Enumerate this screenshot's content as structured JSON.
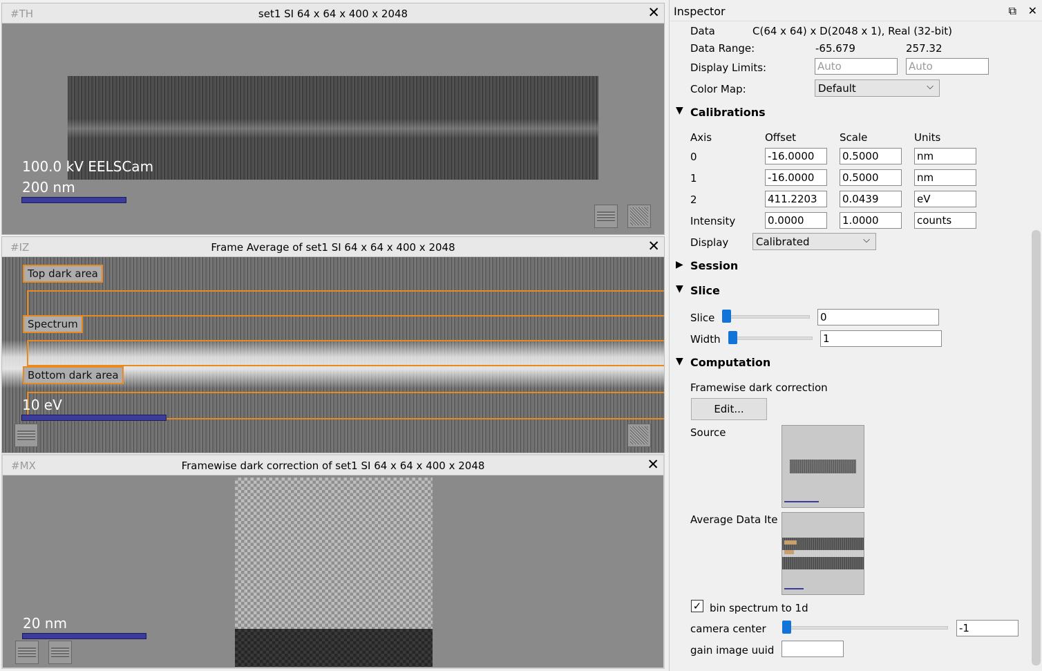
{
  "panels": {
    "top": {
      "tag": "#TH",
      "title": "set1 SI 64 x 64 x 400 x 2048",
      "info": "100.0 kV EELSCam",
      "scale": "200 nm"
    },
    "middle": {
      "tag": "#IZ",
      "title": "Frame Average of set1 SI 64 x 64 x 400 x 2048",
      "regions": [
        "Top dark area",
        "Spectrum",
        "Bottom dark area"
      ],
      "scale": "10 eV"
    },
    "bottom": {
      "tag": "#MX",
      "title": "Framewise dark correction of set1 SI 64 x 64 x 400 x 2048",
      "scale": "20 nm"
    },
    "close_glyph": "✕"
  },
  "inspector": {
    "title": "Inspector",
    "data_label": "Data",
    "data_value": "C(64 x 64) x D(2048 x 1), Real (32-bit)",
    "range_label": "Data Range:",
    "range_min": "-65.679",
    "range_max": "257.32",
    "limits_label": "Display Limits:",
    "limit_low_placeholder": "Auto",
    "limit_high_placeholder": "Auto",
    "colormap_label": "Color Map:",
    "colormap_value": "Default",
    "calibrations": {
      "title": "Calibrations",
      "headers": [
        "Axis",
        "Offset",
        "Scale",
        "Units"
      ],
      "rows": [
        {
          "axis": "0",
          "offset": "-16.0000",
          "scale": "0.5000",
          "units": "nm"
        },
        {
          "axis": "1",
          "offset": "-16.0000",
          "scale": "0.5000",
          "units": "nm"
        },
        {
          "axis": "2",
          "offset": "411.2203",
          "scale": "0.0439",
          "units": "eV"
        },
        {
          "axis": "Intensity",
          "offset": "0.0000",
          "scale": "1.0000",
          "units": "counts"
        }
      ],
      "display_label": "Display",
      "display_value": "Calibrated"
    },
    "session_title": "Session",
    "slice": {
      "title": "Slice",
      "slice_label": "Slice",
      "slice_value": "0",
      "width_label": "Width",
      "width_value": "1"
    },
    "computation": {
      "title": "Computation",
      "name": "Framewise dark correction",
      "edit_label": "Edit...",
      "source_label": "Source",
      "average_label": "Average Data Ite",
      "bin_label": "bin spectrum to 1d",
      "bin_checked": "✓",
      "camera_label": "camera center",
      "camera_value": "-1",
      "gain_label": "gain image uuid",
      "gain_value": ""
    }
  }
}
